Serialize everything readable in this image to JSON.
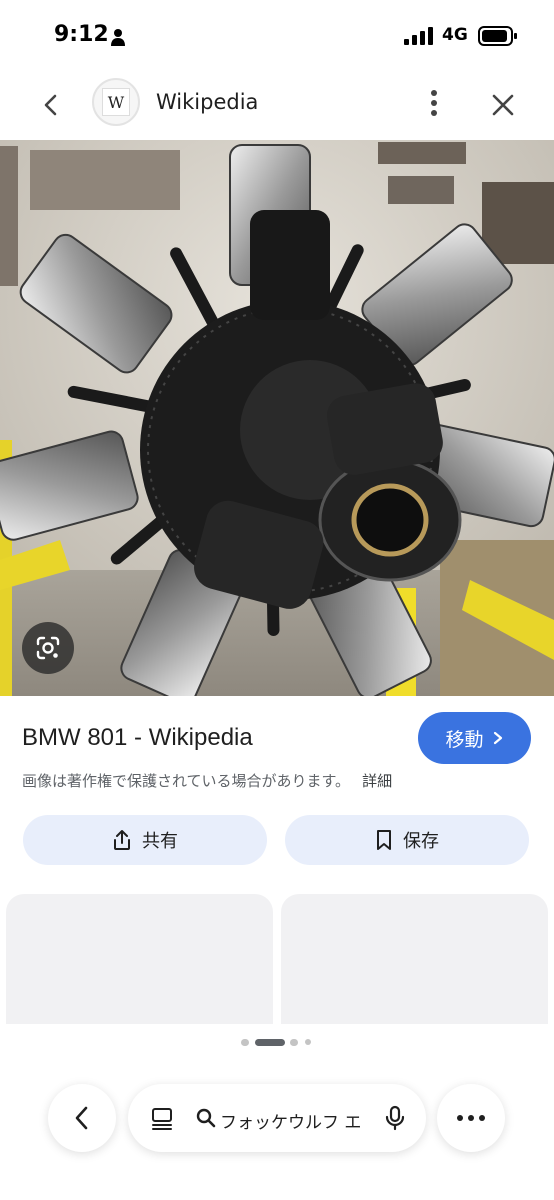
{
  "status_bar": {
    "time": "9:12",
    "network": "4G",
    "icons": [
      "person-icon",
      "signal-icon",
      "battery-icon"
    ]
  },
  "header": {
    "logo_letter": "W",
    "site_name": "Wikipedia",
    "icons": [
      "back-arrow-icon",
      "more-vert-icon",
      "close-icon"
    ]
  },
  "image": {
    "subject": "BMW 801 radial aircraft engine on display",
    "lens_icon": "google-lens-icon"
  },
  "result": {
    "title": "BMW 801 - Wikipedia",
    "visit_label": "移動",
    "copyright_notice": "画像は著作権で保護されている場合があります。",
    "details_label": "詳細"
  },
  "actions": {
    "share_label": "共有",
    "save_label": "保存"
  },
  "pager": {
    "count": 4,
    "active_index": 1
  },
  "bottom_bar": {
    "search_query": "フォッケウルフ エ",
    "icons": [
      "chevron-left-icon",
      "tabs-icon",
      "search-icon",
      "mic-icon",
      "more-horiz-icon"
    ]
  },
  "colors": {
    "accent": "#3a73e0",
    "action_button_bg": "#e8eefb",
    "card_placeholder": "#f1f1f3",
    "secondary_text": "#5f6368"
  }
}
